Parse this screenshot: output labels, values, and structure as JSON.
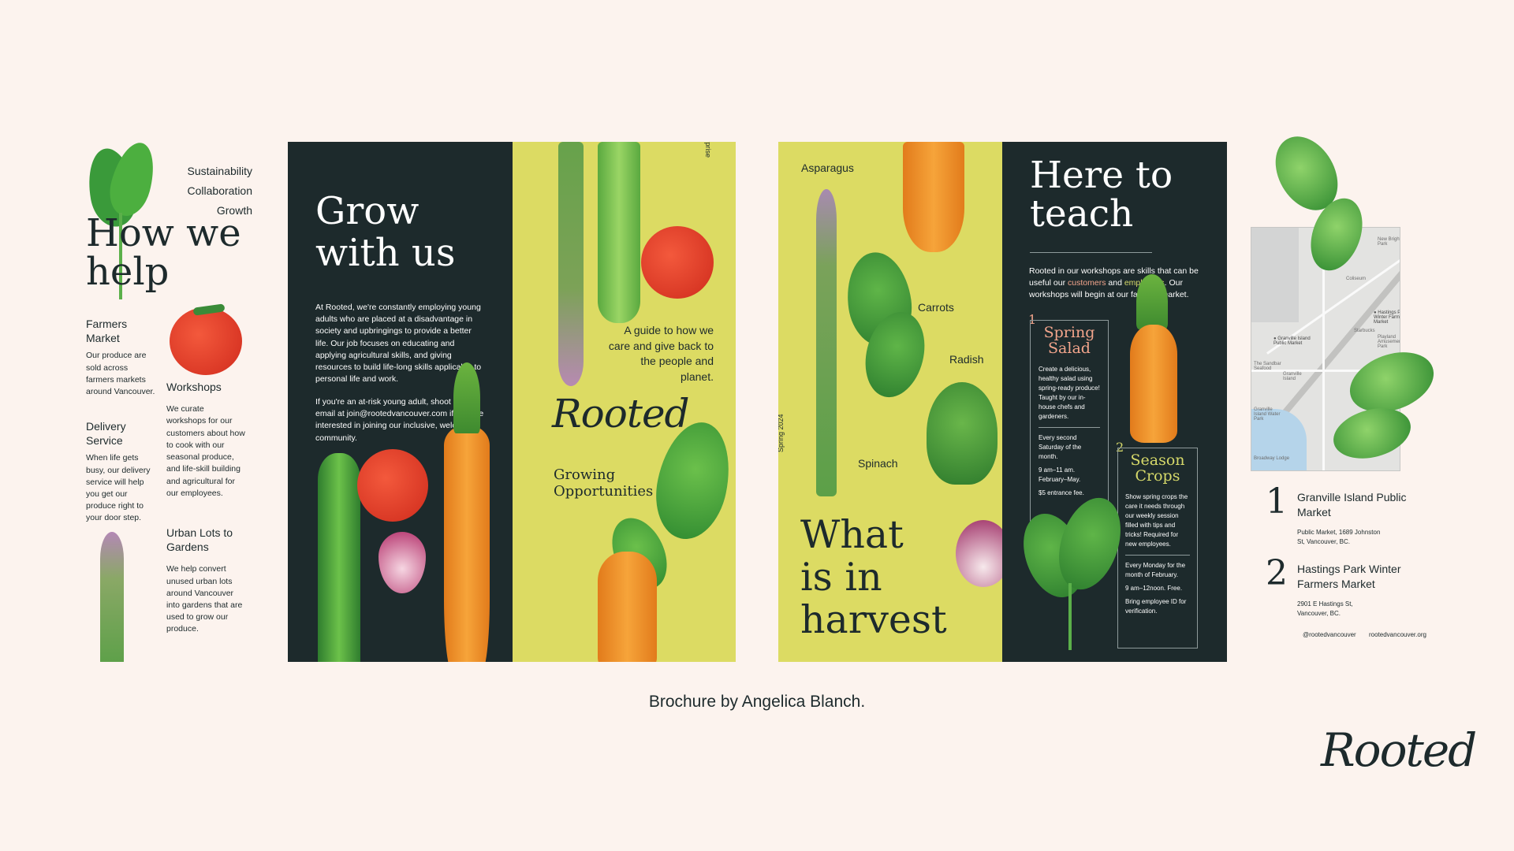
{
  "panel_how": {
    "values": [
      "Sustainability",
      "Collaboration",
      "Growth"
    ],
    "title": "How we help",
    "farmers_title": "Farmers Market",
    "farmers_body": "Our produce are sold across farmers markets around Vancouver.",
    "delivery_title": "Delivery Service",
    "delivery_body": "When life gets busy, our delivery service will help you get our produce right to your door step.",
    "workshops_title": "Workshops",
    "workshops_body": "We curate workshops for our customers about how to cook with our seasonal produce, and life-skill building and agricultural for our employees.",
    "urban_title": "Urban Lots to Gardens",
    "urban_body": "We help convert unused urban lots around Vancouver into gardens that are used to grow our produce."
  },
  "panel_grow": {
    "title_line1": "Grow",
    "title_line2": "with us",
    "body1": "At Rooted, we're constantly employing young adults who are placed at a disadvantage in society and upbringings to provide a better life. Our job focuses on educating and applying agricultural skills, and giving resources to build life-long skills applicable to personal life and work.",
    "body2": "If you're an at-risk young adult, shoot us an email at join@rootedvancouver.com if you are interested in joining our inclusive, welcoming community."
  },
  "panel_cover": {
    "side_label": "Social Enterprise",
    "tagline": "A guide to how we care and give back to the people and planet.",
    "logo": "Rooted",
    "subtitle_line1": "Growing",
    "subtitle_line2": "Opportunities"
  },
  "panel_harvest": {
    "label_asparagus": "Asparagus",
    "label_carrots": "Carrots",
    "label_radish": "Radish",
    "label_spinach": "Spinach",
    "side_label": "Spring 2024",
    "title_line1": "What",
    "title_line2": "is in",
    "title_line3": "harvest"
  },
  "panel_teach": {
    "title_line1": "Here to",
    "title_line2": "teach",
    "intro_a": "Rooted in our workshops are skills that can be useful our ",
    "intro_customers": "customers",
    "intro_and": " and ",
    "intro_employees": "employees",
    "intro_b": ". Our workshops will begin at our farmers market.",
    "w1_num": "1",
    "w1_title": "Spring Salad",
    "w1_desc": "Create a delicious, healthy salad using spring-ready produce! Taught by our in-house chefs and gardeners.",
    "w1_when": "Every second Saturday of the month.",
    "w1_time": "9 am–11 am. February–May.",
    "w1_fee": "$5 entrance fee.",
    "w2_num": "2",
    "w2_title": "Season Crops",
    "w2_desc": "Show spring crops the care it needs through our weekly session filled with tips and tricks! Required for new employees.",
    "w2_when": "Every Monday for the month of February.",
    "w2_time": "9 am–12noon. Free.",
    "w2_note": "Bring employee ID for verification."
  },
  "panel_map": {
    "map_labels": {
      "new_brighton": "New Brighton Park",
      "hastings_pin": "Hastings Park Winter Farmers Market",
      "playland": "Playland Amusement Park",
      "coliseum": "Coliseum",
      "starbucks": "Starbucks",
      "granville_pin": "Granville Island Public Market",
      "granville": "Granville Island",
      "water_park": "Granville Island Water Park",
      "sandbar": "The Sandbar Seafood",
      "broadway": "Broadway Lodge"
    },
    "loc1_num": "1",
    "loc1_name": "Granville Island Public Market",
    "loc1_addr": "Public Market, 1689 Johnston St, Vancouver, BC.",
    "loc2_num": "2",
    "loc2_name": "Hastings Park Winter Farmers Market",
    "loc2_addr": "2901 E Hastings St, Vancouver, BC.",
    "social": "@rootedvancouver",
    "website": "rootedvancouver.org"
  },
  "caption": "Brochure by Angelica Blanch.",
  "brand_logo": "Rooted",
  "colors": {
    "background": "#fcf3ee",
    "dark": "#1d2a2c",
    "yellow": "#dcdb63",
    "salmon": "#f3a58c",
    "lime": "#d6d96a"
  }
}
